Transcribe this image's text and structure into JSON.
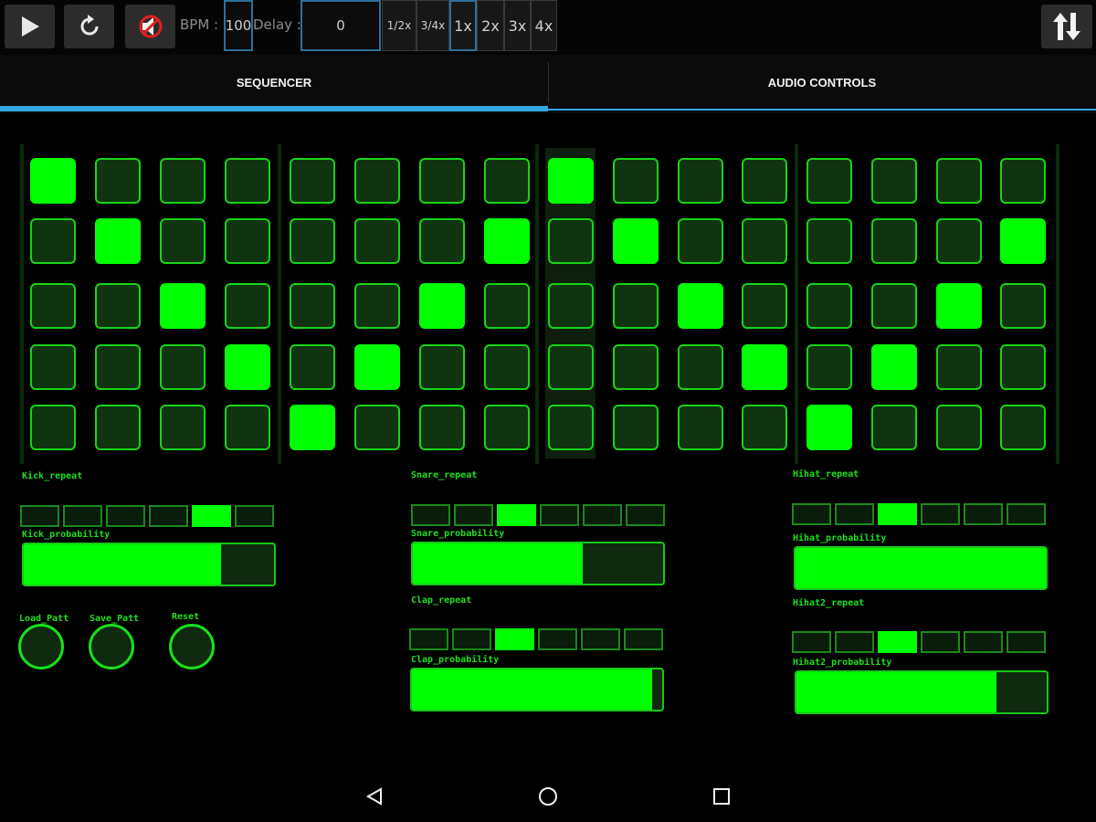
{
  "toolbar": {
    "bpm_label": "BPM :",
    "bpm_value": "100",
    "delay_label": "Delay :",
    "delay_value": "0",
    "delay_options": [
      "1/2x",
      "3/4x"
    ],
    "multipliers": [
      "1x",
      "2x",
      "3x",
      "4x"
    ],
    "selected_multiplier": "1x",
    "play_icon": "play-icon",
    "reset_icon": "refresh-icon",
    "mute_icon": "speaker-muted-icon",
    "swap_icon": "swap-vertical-icon"
  },
  "tabs": [
    "SEQUENCER",
    "AUDIO CONTROLS"
  ],
  "active_tab": "SEQUENCER",
  "sequencer": {
    "rows": 5,
    "steps": 16,
    "active_pads": [
      [
        0,
        0
      ],
      [
        0,
        8
      ],
      [
        1,
        1
      ],
      [
        1,
        7
      ],
      [
        1,
        9
      ],
      [
        1,
        15
      ],
      [
        2,
        2
      ],
      [
        2,
        6
      ],
      [
        2,
        10
      ],
      [
        2,
        14
      ],
      [
        3,
        3
      ],
      [
        3,
        5
      ],
      [
        3,
        11
      ],
      [
        3,
        13
      ],
      [
        4,
        4
      ],
      [
        4,
        12
      ]
    ],
    "highlighted_step": 8
  },
  "instruments": {
    "kick": {
      "repeat_label": "Kick_repeat",
      "repeat_selected": 4,
      "probability_label": "Kick_probability",
      "probability": 0.79
    },
    "snare": {
      "repeat_label": "Snare_repeat",
      "repeat_selected": 2,
      "probability_label": "Snare_probability",
      "probability": 0.68
    },
    "clap": {
      "repeat_label": "Clap_repeat",
      "repeat_selected": 2,
      "probability_label": "Clap_probability",
      "probability": 0.96
    },
    "hihat": {
      "repeat_label": "Hihat_repeat",
      "repeat_selected": 2,
      "probability_label": "Hihat_probability",
      "probability": 1.0
    },
    "hihat2": {
      "repeat_label": "Hihat2_repeat",
      "repeat_selected": 2,
      "probability_label": "Hihat2_probability",
      "probability": 0.8
    }
  },
  "repeat_cells": 6,
  "pattern_buttons": {
    "load": "Load_Patt",
    "save": "Save_Patt",
    "reset": "Reset"
  },
  "colors": {
    "active": "#00ff00",
    "accent": "#33a7e2"
  },
  "nav": {
    "back_icon": "back-triangle-icon",
    "home_icon": "home-circle-icon",
    "recents_icon": "recents-square-icon"
  }
}
